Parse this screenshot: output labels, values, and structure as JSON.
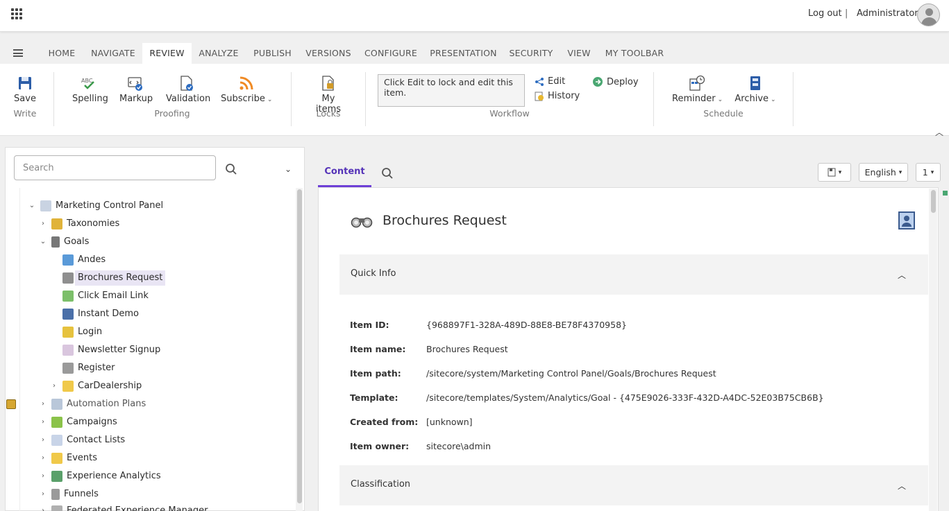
{
  "header": {
    "logout": "Log out",
    "separator": "|",
    "user": "Administrator"
  },
  "ribbon_tabs": [
    "HOME",
    "NAVIGATE",
    "REVIEW",
    "ANALYZE",
    "PUBLISH",
    "VERSIONS",
    "CONFIGURE",
    "PRESENTATION",
    "SECURITY",
    "VIEW",
    "MY TOOLBAR"
  ],
  "active_tab": "REVIEW",
  "ribbon": {
    "save": "Save",
    "write_group": "Write",
    "spelling": "Spelling",
    "markup": "Markup",
    "validation": "Validation",
    "subscribe": "Subscribe",
    "proofing_group": "Proofing",
    "my_items": "My items",
    "locks_group": "Locks",
    "workflow_message": "Click Edit to lock and edit this item.",
    "edit": "Edit",
    "history": "History",
    "deploy": "Deploy",
    "workflow_group": "Workflow",
    "reminder": "Reminder",
    "archive": "Archive",
    "schedule_group": "Schedule"
  },
  "tree_search": {
    "placeholder": "Search"
  },
  "tree": {
    "root": "Marketing Control Panel",
    "taxonomies": "Taxonomies",
    "goals": "Goals",
    "goals_children": [
      "Andes",
      "Brochures Request",
      "Click Email Link",
      "Instant Demo",
      "Login",
      "Newsletter Signup",
      "Register",
      "CarDealership"
    ],
    "automation_plans": "Automation Plans",
    "campaigns": "Campaigns",
    "contact_lists": "Contact Lists",
    "events": "Events",
    "experience_analytics": "Experience Analytics",
    "funnels": "Funnels",
    "federated": "Federated Experience Manager"
  },
  "editor": {
    "tab_content": "Content",
    "view_dd": "▾",
    "language": "English",
    "version": "1",
    "title": "Brochures Request",
    "quick_info": "Quick Info",
    "classification": "Classification",
    "fields": {
      "item_id_label": "Item ID:",
      "item_id": "{968897F1-328A-489D-88E8-BE78F4370958}",
      "item_name_label": "Item name:",
      "item_name": "Brochures Request",
      "item_path_label": "Item path:",
      "item_path": "/sitecore/system/Marketing Control Panel/Goals/Brochures Request",
      "template_label": "Template:",
      "template": "/sitecore/templates/System/Analytics/Goal - {475E9026-333F-432D-A4DC-52E03B75CB6B}",
      "created_from_label": "Created from:",
      "created_from": "[unknown]",
      "item_owner_label": "Item owner:",
      "item_owner": "sitecore\\admin"
    }
  },
  "colors": {
    "accent": "#6e3fd6",
    "selected_bg": "#e9e5f4"
  }
}
